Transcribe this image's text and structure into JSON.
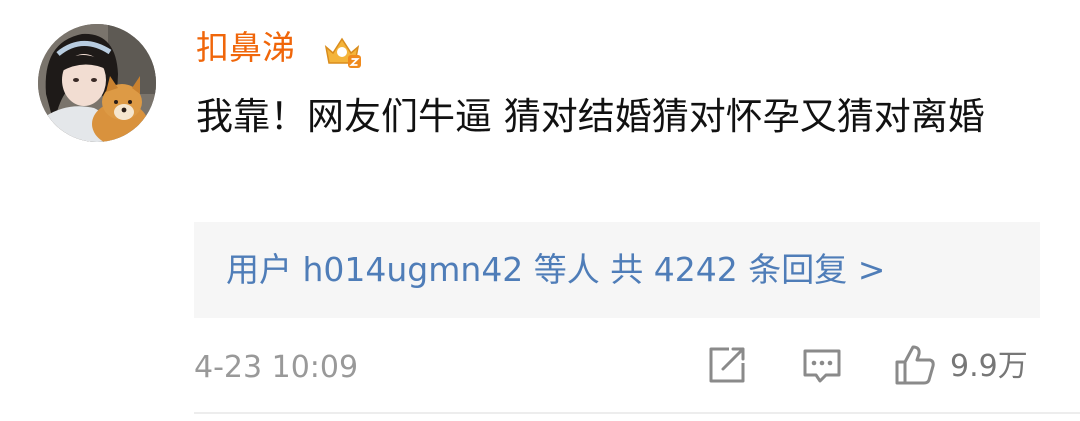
{
  "comment": {
    "username": "扣鼻涕",
    "text": "我靠！网友们牛逼 猜对结婚猜对怀孕又猜对离婚",
    "replies": {
      "summary": "用户 h014ugmn42 等人  共 4242 条回复 >"
    },
    "timestamp": "4-23 10:09",
    "like_count": "9.9万"
  },
  "icons": {
    "vip": "vip-crown-icon",
    "share": "share-icon",
    "reply": "comment-icon",
    "like": "thumbs-up-icon"
  },
  "colors": {
    "username": "#f0660a",
    "reply_link": "#4f7db8",
    "meta_gray": "#999999",
    "reply_box_bg": "#f6f6f6"
  }
}
